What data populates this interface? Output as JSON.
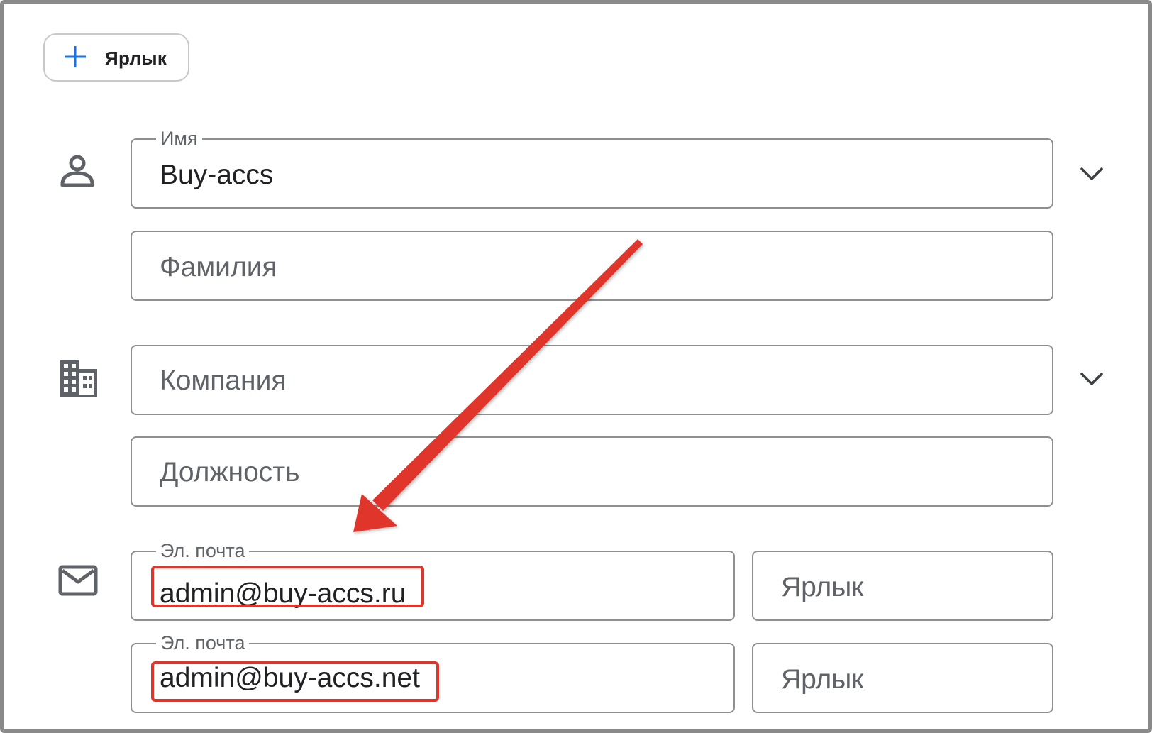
{
  "toolbar": {
    "add_label_button": "Ярлык"
  },
  "name_section": {
    "first_name": {
      "label": "Имя",
      "value": "Buy-accs"
    },
    "last_name": {
      "placeholder": "Фамилия"
    }
  },
  "company_section": {
    "company": {
      "placeholder": "Компания"
    },
    "job_title": {
      "placeholder": "Должность"
    }
  },
  "email_section": {
    "emails": [
      {
        "label": "Эл. почта",
        "value": "admin@buy-accs.ru",
        "tag_placeholder": "Ярлык"
      },
      {
        "label": "Эл. почта",
        "value": "admin@buy-accs.net",
        "tag_placeholder": "Ярлык"
      }
    ]
  },
  "icons": {
    "add": "plus-icon",
    "person": "person-icon",
    "company": "building-icon",
    "email": "mail-icon",
    "expand": "chevron-down-icon"
  },
  "colors": {
    "accent_blue": "#1a73e8",
    "annotation_red": "#e0352b",
    "border_gray": "#8f8f8f",
    "icon_gray": "#5f6368",
    "text_dark": "#202124"
  }
}
